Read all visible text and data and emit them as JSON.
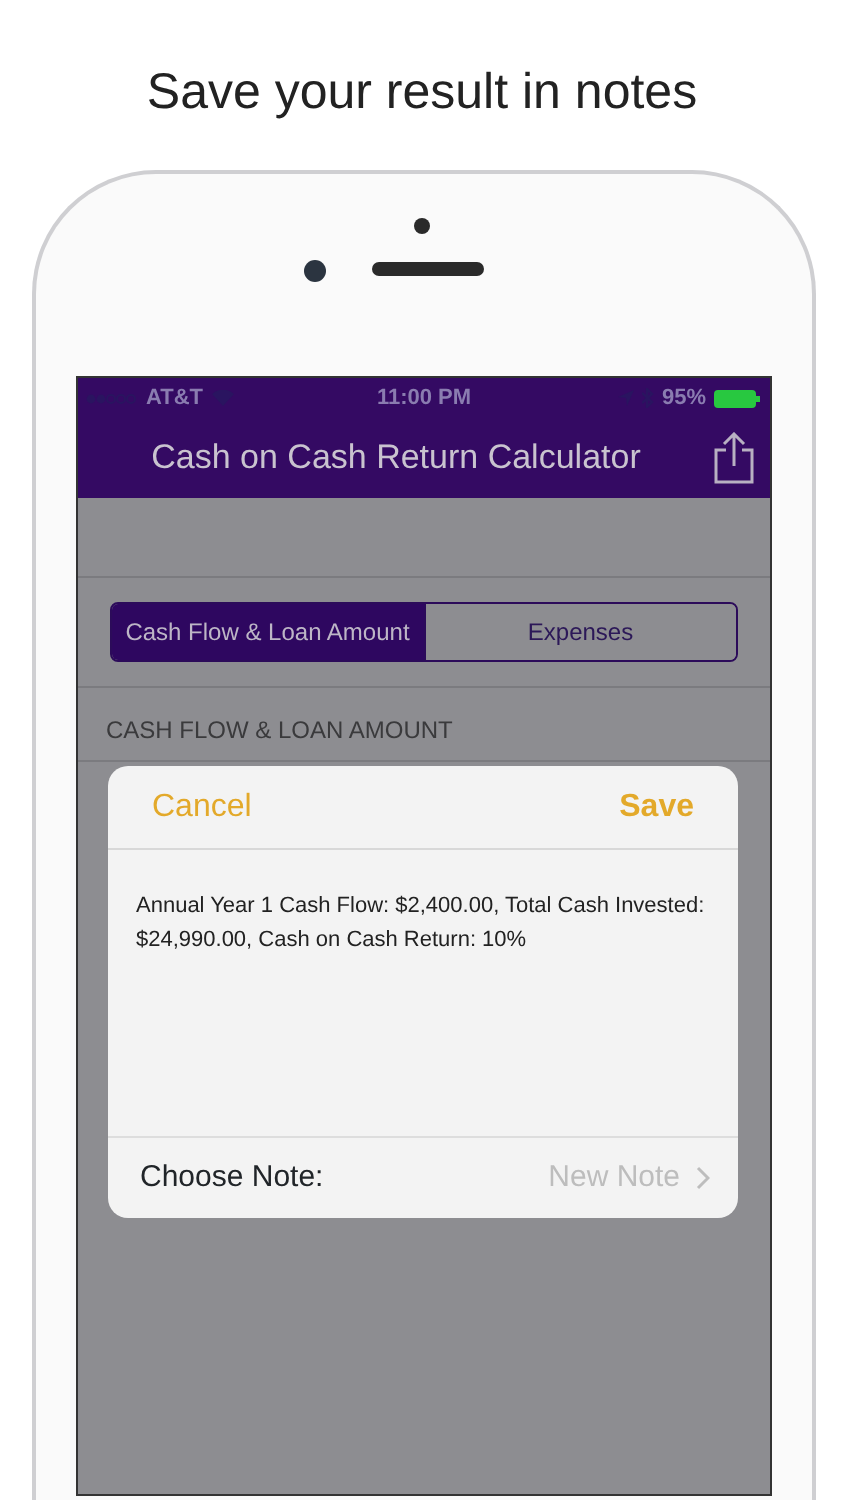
{
  "headline": "Save your result in notes",
  "status_bar": {
    "carrier": "AT&T",
    "time": "11:00 PM",
    "battery": "95%"
  },
  "nav_bar": {
    "title": "Cash on Cash Return Calculator"
  },
  "segments": [
    {
      "label": "Cash Flow & Loan Amount",
      "selected": true
    },
    {
      "label": "Expenses",
      "selected": false
    }
  ],
  "section_header": "CASH FLOW & LOAN AMOUNT",
  "dialog": {
    "cancel": "Cancel",
    "save": "Save",
    "note_text": "Annual Year 1 Cash Flow: $2,400.00, Total Cash Invested: $24,990.00, Cash on Cash Return: 10%",
    "choose_label": "Choose Note:",
    "choose_value": "New Note"
  }
}
